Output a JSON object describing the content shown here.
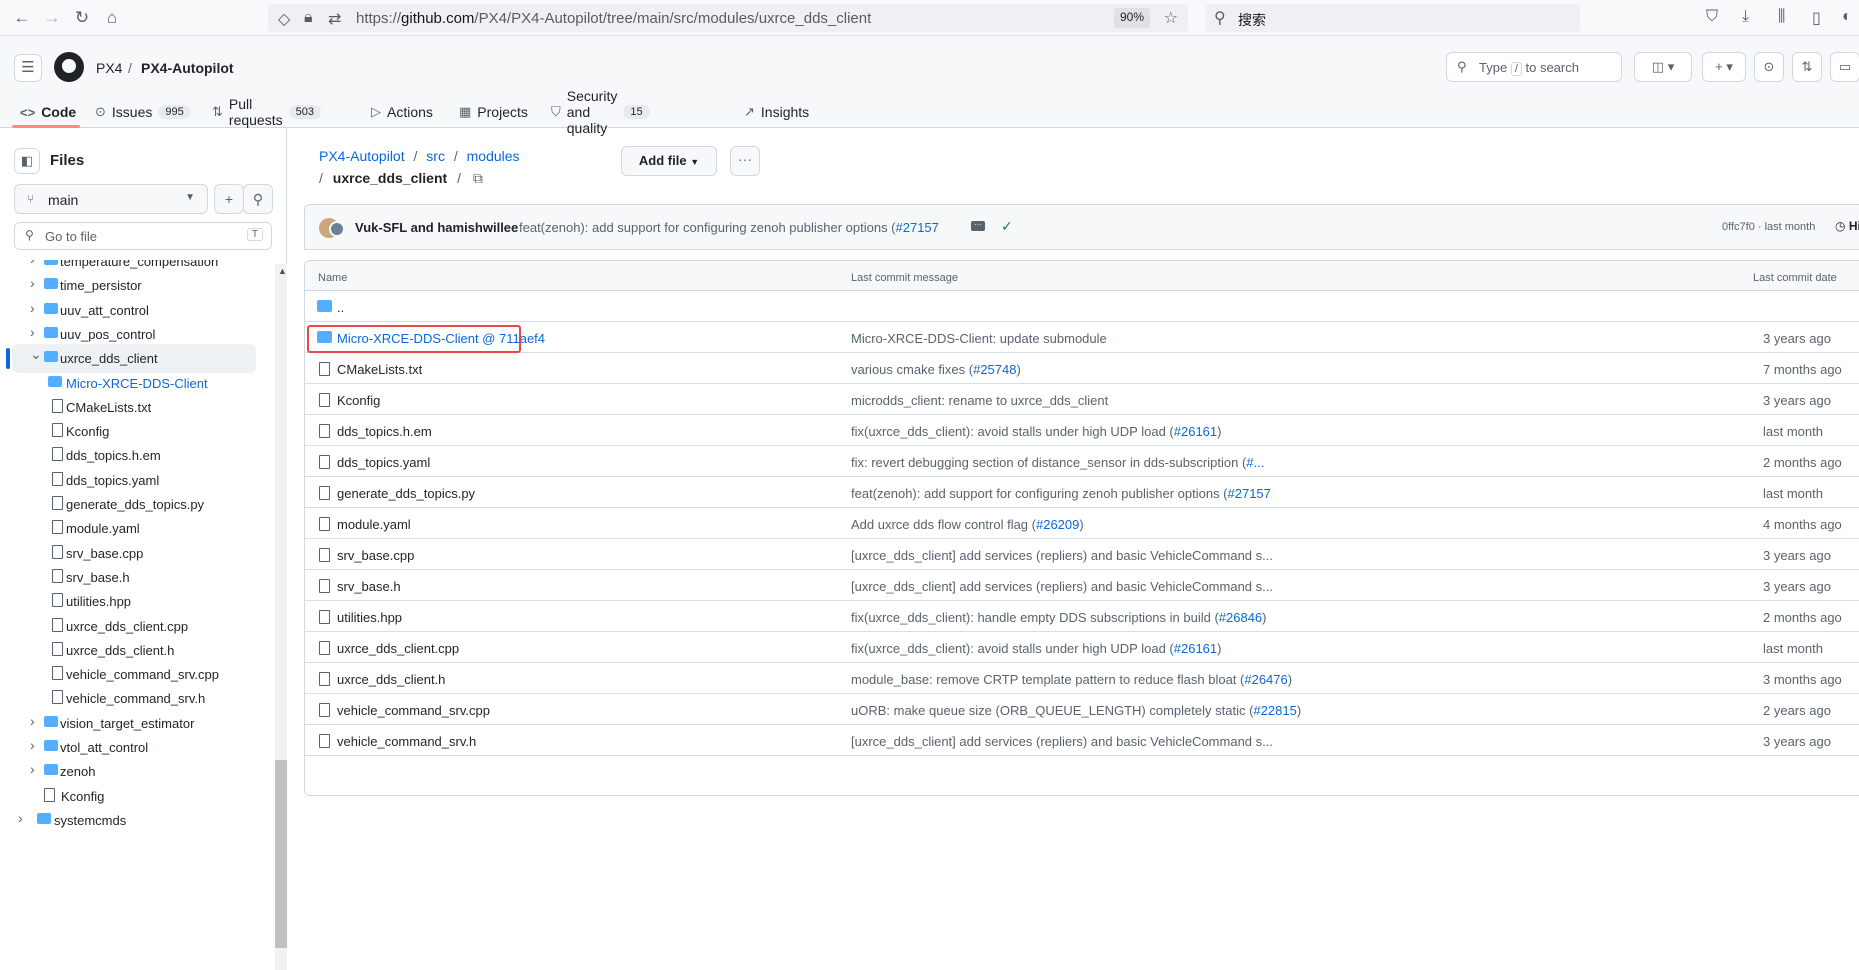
{
  "browser": {
    "url_prefix": "https://",
    "url_domain": "github.com",
    "url_path": "/PX4/PX4-Autopilot/tree/main/src/modules/uxrce_dds_client",
    "zoom": "90%",
    "search_placeholder": "搜索",
    "icons": [
      "back-icon",
      "forward-icon",
      "reload-icon",
      "home-icon",
      "shield-icon",
      "lock-icon",
      "star-icon",
      "pocket-icon",
      "download-icon",
      "library-icon",
      "sidebar-icon",
      "account-icon"
    ]
  },
  "header": {
    "owner": "PX4",
    "separator": "/",
    "repo": "PX4-Autopilot",
    "search_prefix": "Type",
    "search_key": "/",
    "search_suffix": "to search",
    "plus": "+",
    "caret": "▾"
  },
  "nav": {
    "code": "Code",
    "issues": "Issues",
    "issues_count": "995",
    "pulls": "Pull requests",
    "pulls_count": "503",
    "actions": "Actions",
    "projects": "Projects",
    "security": "Security and quality",
    "security_count": "15",
    "insights": "Insights"
  },
  "sidebar": {
    "title": "Files",
    "branch": "main",
    "goto_placeholder": "Go to file",
    "goto_key": "T",
    "items": [
      {
        "label": "temperature_compensation",
        "type": "folder"
      },
      {
        "label": "time_persistor",
        "type": "folder"
      },
      {
        "label": "uuv_att_control",
        "type": "folder"
      },
      {
        "label": "uuv_pos_control",
        "type": "folder"
      },
      {
        "label": "uxrce_dds_client",
        "type": "folder-open"
      },
      {
        "label": "Micro-XRCE-DDS-Client",
        "type": "submodule"
      },
      {
        "label": "CMakeLists.txt",
        "type": "file"
      },
      {
        "label": "Kconfig",
        "type": "file"
      },
      {
        "label": "dds_topics.h.em",
        "type": "file"
      },
      {
        "label": "dds_topics.yaml",
        "type": "file"
      },
      {
        "label": "generate_dds_topics.py",
        "type": "file"
      },
      {
        "label": "module.yaml",
        "type": "file"
      },
      {
        "label": "srv_base.cpp",
        "type": "file"
      },
      {
        "label": "srv_base.h",
        "type": "file"
      },
      {
        "label": "utilities.hpp",
        "type": "file"
      },
      {
        "label": "uxrce_dds_client.cpp",
        "type": "file"
      },
      {
        "label": "uxrce_dds_client.h",
        "type": "file"
      },
      {
        "label": "vehicle_command_srv.cpp",
        "type": "file"
      },
      {
        "label": "vehicle_command_srv.h",
        "type": "file"
      },
      {
        "label": "vision_target_estimator",
        "type": "folder"
      },
      {
        "label": "vtol_att_control",
        "type": "folder"
      },
      {
        "label": "zenoh",
        "type": "folder"
      },
      {
        "label": "Kconfig",
        "type": "file"
      },
      {
        "label": "systemcmds",
        "type": "folder"
      }
    ]
  },
  "breadcrumb": {
    "repo": "PX4-Autopilot",
    "sep": "/",
    "src": "src",
    "modules": "modules",
    "current": "uxrce_dds_client",
    "add_file": "Add file",
    "more": "···"
  },
  "commit": {
    "authors": "Vuk-SFL and hamishwillee",
    "message": "feat(zenoh): add support for configuring zenoh publisher options (",
    "pr": "#27157",
    "sha_time": "0ffc7f0 · last month",
    "history": "History"
  },
  "table": {
    "col_name": "Name",
    "col_message": "Last commit message",
    "col_date": "Last commit date",
    "parent": "..",
    "rows": [
      {
        "name": "Micro-XRCE-DDS-Client @ 711aef4",
        "kind": "submodule",
        "msg": "Micro-XRCE-DDS-Client: update submodule",
        "pr": "",
        "tail": "",
        "when": "3 years ago"
      },
      {
        "name": "CMakeLists.txt",
        "kind": "file",
        "msg": "various cmake fixes (",
        "pr": "#25748",
        "tail": ")",
        "when": "7 months ago"
      },
      {
        "name": "Kconfig",
        "kind": "file",
        "msg": "microdds_client: rename to uxrce_dds_client",
        "pr": "",
        "tail": "",
        "when": "3 years ago"
      },
      {
        "name": "dds_topics.h.em",
        "kind": "file",
        "msg": "fix(uxrce_dds_client): avoid stalls under high UDP load (",
        "pr": "#26161",
        "tail": ")",
        "when": "last month"
      },
      {
        "name": "dds_topics.yaml",
        "kind": "file",
        "msg": "fix: revert debugging section of distance_sensor in dds-subscription (",
        "pr": "#...",
        "tail": "",
        "when": "2 months ago"
      },
      {
        "name": "generate_dds_topics.py",
        "kind": "file",
        "msg": "feat(zenoh): add support for configuring zenoh publisher options (",
        "pr": "#27157",
        "tail": "",
        "when": "last month"
      },
      {
        "name": "module.yaml",
        "kind": "file",
        "msg": "Add uxrce dds flow control flag (",
        "pr": "#26209",
        "tail": ")",
        "when": "4 months ago"
      },
      {
        "name": "srv_base.cpp",
        "kind": "file",
        "msg": "[uxrce_dds_client] add services (repliers) and basic VehicleCommand s...",
        "pr": "",
        "tail": "",
        "when": "3 years ago"
      },
      {
        "name": "srv_base.h",
        "kind": "file",
        "msg": "[uxrce_dds_client] add services (repliers) and basic VehicleCommand s...",
        "pr": "",
        "tail": "",
        "when": "3 years ago"
      },
      {
        "name": "utilities.hpp",
        "kind": "file",
        "msg": "fix(uxrce_dds_client): handle empty DDS subscriptions in build (",
        "pr": "#26846",
        "tail": ")",
        "when": "2 months ago"
      },
      {
        "name": "uxrce_dds_client.cpp",
        "kind": "file",
        "msg": "fix(uxrce_dds_client): avoid stalls under high UDP load (",
        "pr": "#26161",
        "tail": ")",
        "when": "last month"
      },
      {
        "name": "uxrce_dds_client.h",
        "kind": "file",
        "msg": "module_base: remove CRTP template pattern to reduce flash bloat (",
        "pr": "#26476",
        "tail": ")",
        "when": "3 months ago"
      },
      {
        "name": "vehicle_command_srv.cpp",
        "kind": "file",
        "msg": "uORB: make queue size (ORB_QUEUE_LENGTH) completely static (",
        "pr": "#22815",
        "tail": ")",
        "when": "2 years ago"
      },
      {
        "name": "vehicle_command_srv.h",
        "kind": "file",
        "msg": "[uxrce_dds_client] add services (repliers) and basic VehicleCommand s...",
        "pr": "",
        "tail": "",
        "when": "3 years ago"
      }
    ]
  }
}
